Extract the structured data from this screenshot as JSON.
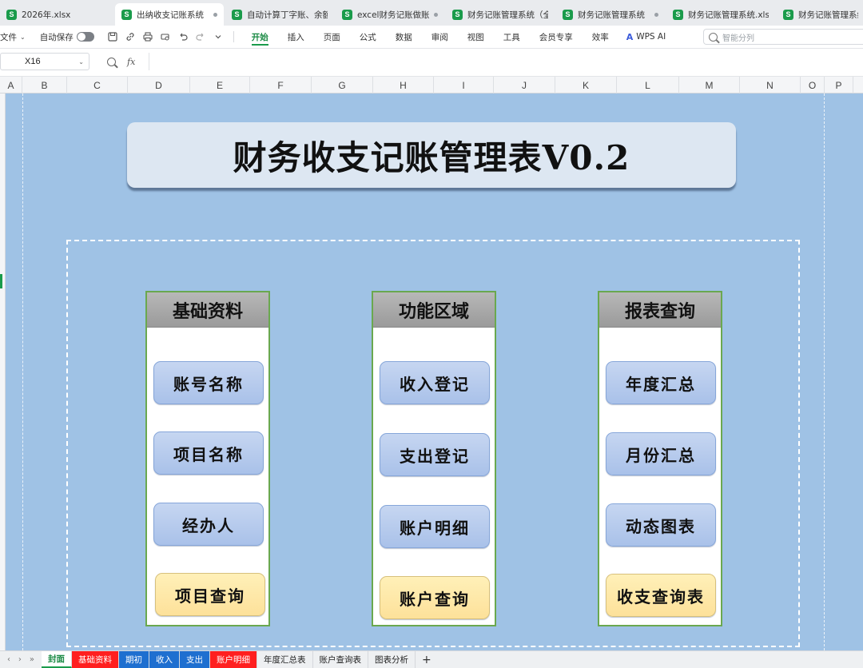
{
  "doc_tabs": [
    {
      "label": "2026年.xlsx",
      "active": false,
      "dot": false
    },
    {
      "label": "出纳收支记账系统（",
      "active": true,
      "dot": true
    },
    {
      "label": "自动计算丁字账、余额",
      "active": false,
      "dot": false
    },
    {
      "label": "excel财务记账做账系",
      "active": false,
      "dot": true
    },
    {
      "label": "财务记账管理系统（全",
      "active": false,
      "dot": false
    },
    {
      "label": "财务记账管理系统（",
      "active": false,
      "dot": true
    },
    {
      "label": "财务记账管理系统.xls",
      "active": false,
      "dot": false
    },
    {
      "label": "财务记账管理系统",
      "active": false,
      "dot": false
    }
  ],
  "doc_tab_icon": "S",
  "ribbon": {
    "file_label": "文件",
    "autosave_label": "自动保存",
    "menu_tabs": [
      "开始",
      "插入",
      "页面",
      "公式",
      "数据",
      "审阅",
      "视图",
      "工具",
      "会员专享",
      "效率"
    ],
    "active_menu": "开始",
    "wps_ai_label": "WPS AI",
    "search_placeholder": "智能分列"
  },
  "formula_bar": {
    "cell_ref": "X16",
    "fx_label": "fx",
    "value": ""
  },
  "columns": [
    "A",
    "B",
    "C",
    "D",
    "E",
    "F",
    "G",
    "H",
    "I",
    "J",
    "K",
    "L",
    "M",
    "N",
    "O",
    "P"
  ],
  "sheet": {
    "title": "财务收支记账管理表V0.2",
    "panels": [
      {
        "header": "基础资料",
        "buttons": [
          "账号名称",
          "项目名称",
          "经办人",
          "项目查询"
        ]
      },
      {
        "header": "功能区域",
        "buttons": [
          "收入登记",
          "支出登记",
          "账户明细",
          "账户查询"
        ]
      },
      {
        "header": "报表查询",
        "buttons": [
          "年度汇总",
          "月份汇总",
          "动态图表",
          "收支查询表"
        ]
      }
    ]
  },
  "sheet_tabs": [
    {
      "label": "封面",
      "style": "active"
    },
    {
      "label": "基础资料",
      "style": "red"
    },
    {
      "label": "期初",
      "style": "blue"
    },
    {
      "label": "收入",
      "style": "blue"
    },
    {
      "label": "支出",
      "style": "blue"
    },
    {
      "label": "账户明细",
      "style": "red"
    },
    {
      "label": "年度汇总表",
      "style": "plain"
    },
    {
      "label": "账户查询表",
      "style": "plain"
    },
    {
      "label": "图表分析",
      "style": "plain"
    }
  ],
  "add_sheet_label": "+",
  "colors": {
    "sheet_bg": "#9fc2e5",
    "accent_green": "#1a9b4b",
    "button_blue": "#a9c1e9",
    "button_yellow": "#fde19a",
    "tab_red": "#ff1f1f",
    "tab_blue": "#1e6fd0"
  }
}
